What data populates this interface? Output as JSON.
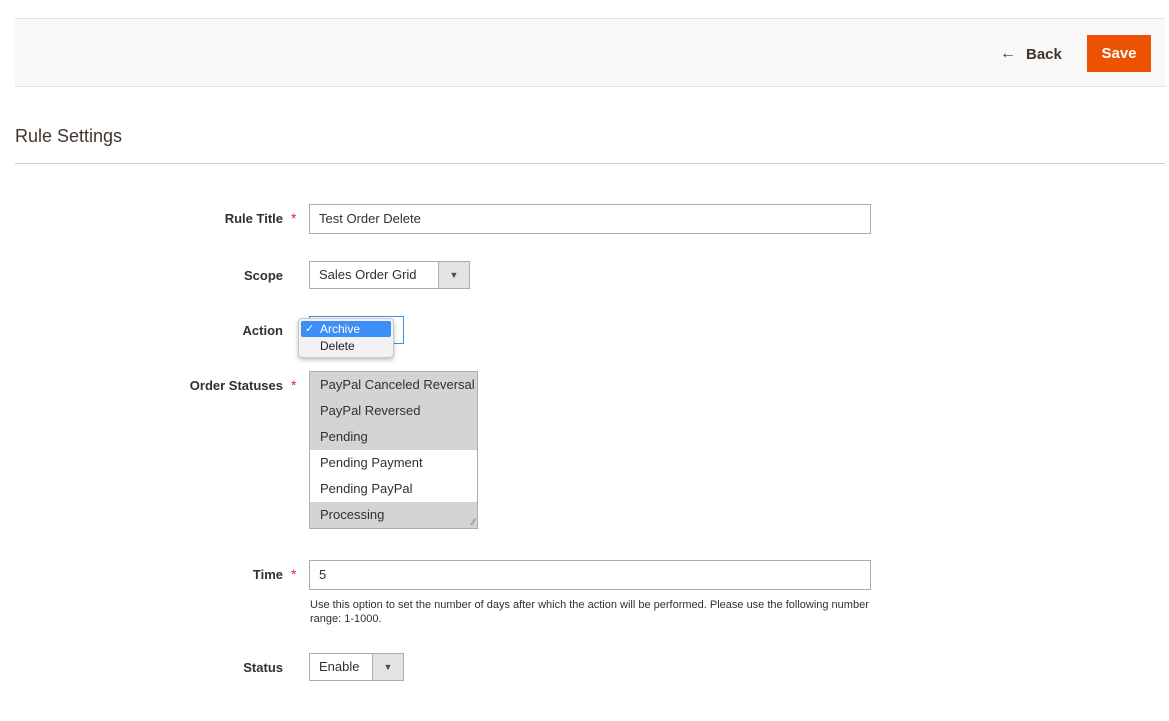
{
  "toolbar": {
    "back_label": "Back",
    "save_label": "Save"
  },
  "section": {
    "title": "Rule Settings"
  },
  "form": {
    "rule_title": {
      "label": "Rule Title",
      "value": "Test Order Delete",
      "required": "*"
    },
    "scope": {
      "label": "Scope",
      "value": "Sales Order Grid"
    },
    "action": {
      "label": "Action",
      "options": [
        "Archive",
        "Delete"
      ],
      "selected": "Archive"
    },
    "order_statuses": {
      "label": "Order Statuses",
      "required": "*",
      "options": [
        {
          "label": "PayPal Canceled Reversal",
          "selected": true
        },
        {
          "label": "PayPal Reversed",
          "selected": true
        },
        {
          "label": "Pending",
          "selected": true
        },
        {
          "label": "Pending Payment",
          "selected": false
        },
        {
          "label": "Pending PayPal",
          "selected": false
        },
        {
          "label": "Processing",
          "selected": true
        }
      ]
    },
    "time": {
      "label": "Time",
      "required": "*",
      "value": "5",
      "note": "Use this option to set the number of days after which the action will be performed. Please use the following number range: 1-1000."
    },
    "status": {
      "label": "Status",
      "value": "Enable"
    }
  },
  "icons": {
    "back": "arrow-left-icon",
    "select_arrow": "caret-down-icon",
    "check": "checkmark-icon",
    "resize": "resize-grip-icon"
  },
  "colors": {
    "accent": "#eb5202",
    "required": "#e22626",
    "selection": "#3d8ef7"
  }
}
